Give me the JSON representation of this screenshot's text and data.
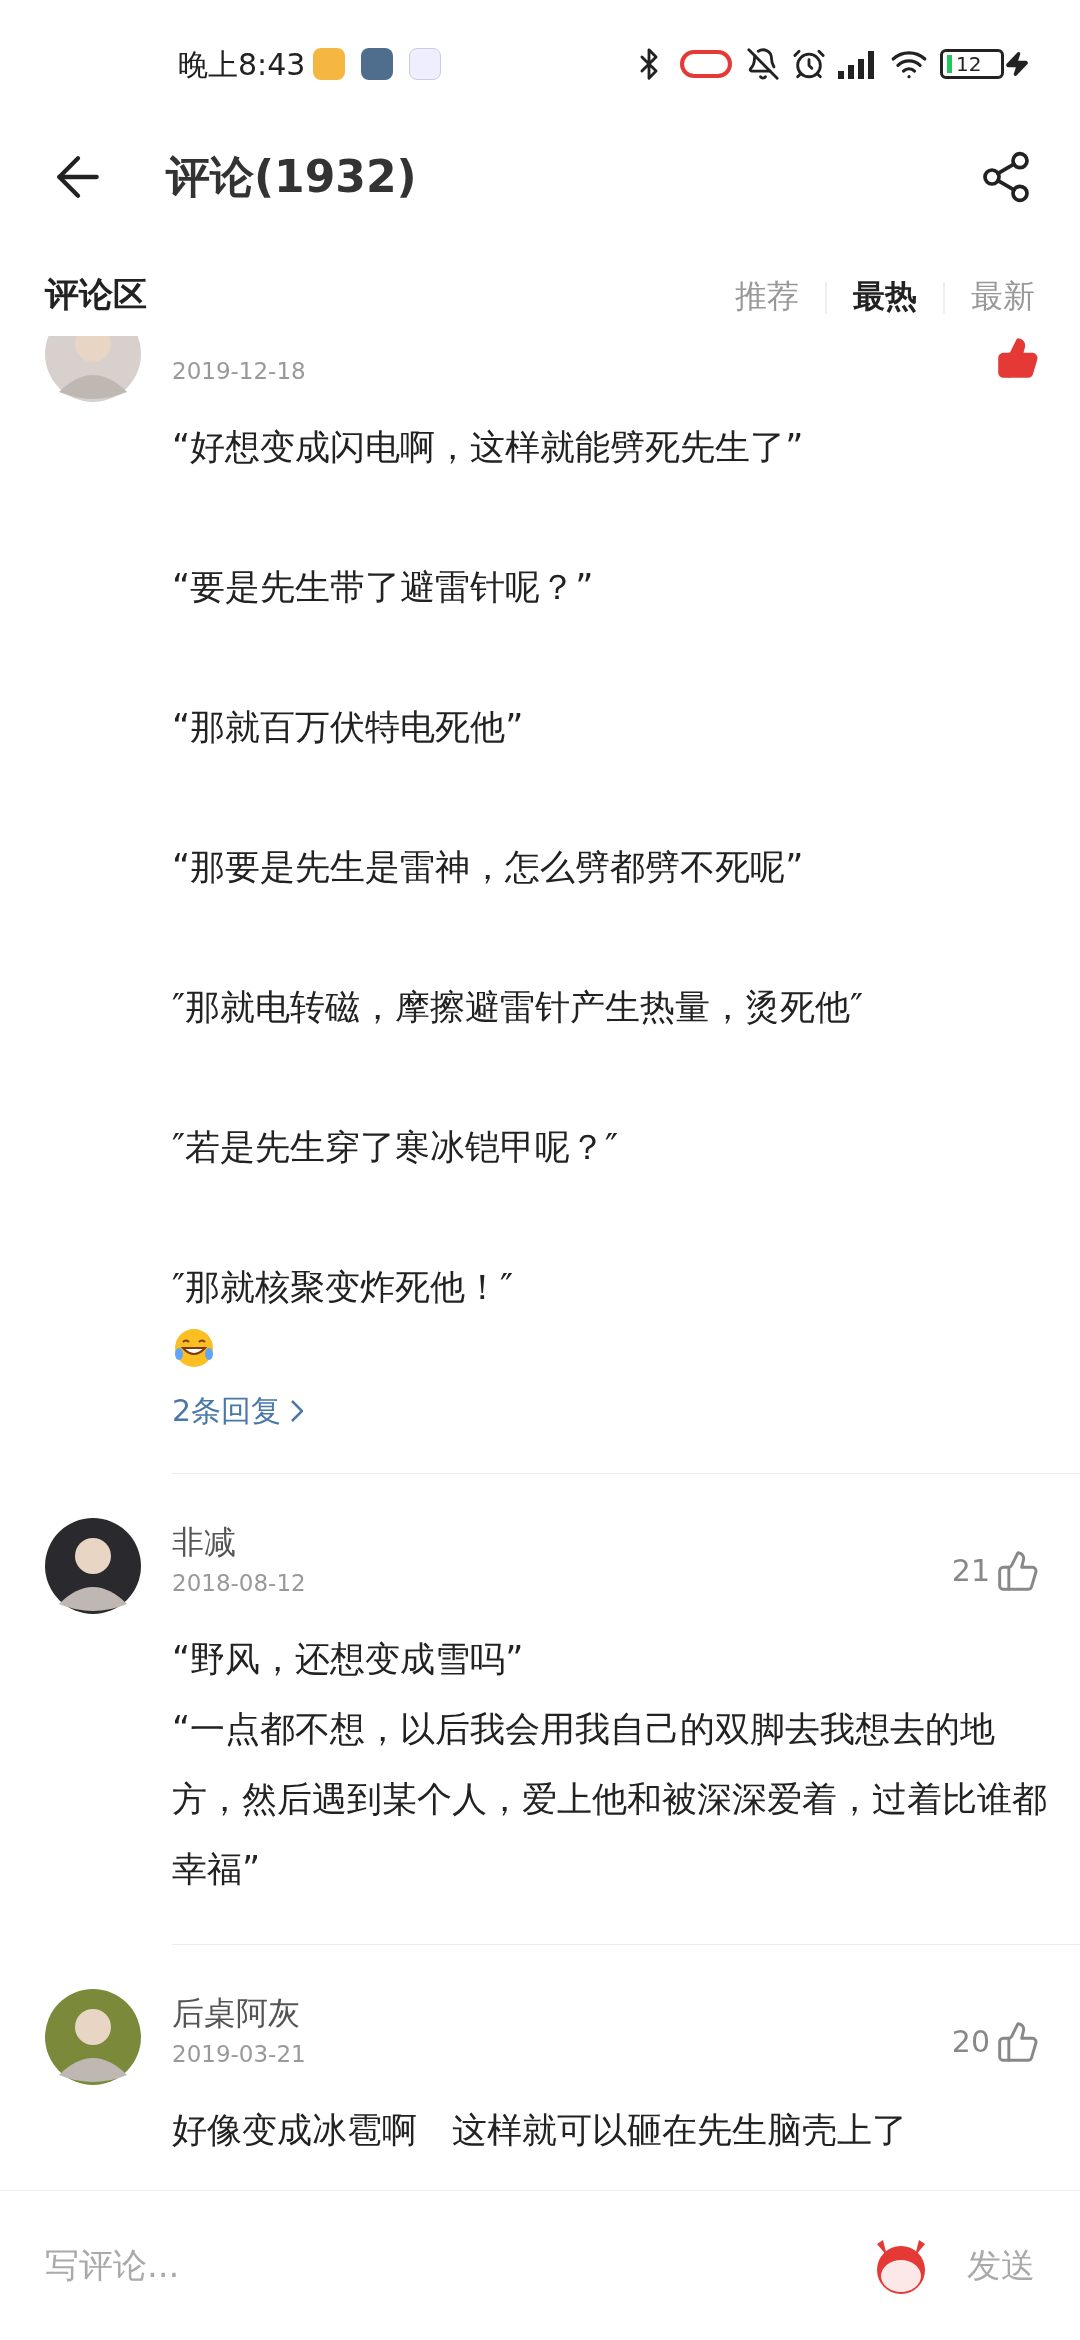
{
  "status_bar": {
    "time": "晚上8:43",
    "battery": "12"
  },
  "header": {
    "title": "评论(1932)"
  },
  "section": {
    "title": "评论区",
    "tabs": [
      {
        "label": "推荐",
        "selected": false
      },
      {
        "label": "最热",
        "selected": true
      },
      {
        "label": "最新",
        "selected": false
      }
    ]
  },
  "comments": [
    {
      "date": "2019-12-18",
      "liked": true,
      "text": "“好想变成闪电啊，这样就能劈死先生了”\n\n“要是先生带了避雷针呢？”\n\n“那就百万伏特电死他”\n\n“那要是先生是雷神，怎么劈都劈不死呢”\n\n″那就电转磁，摩擦避雷针产生热量，烫死他″\n\n″若是先生穿了寒冰铠甲呢？″\n\n″那就核聚变炸死他！″",
      "emoji": true,
      "replies": "2条回复"
    },
    {
      "name": "非减",
      "date": "2018-08-12",
      "likes": "21",
      "liked": false,
      "text": "“野风，还想变成雪吗”\n“一点都不想，以后我会用我自己的双脚去我想去的地方，然后遇到某个人，爱上他和被深深爱着，过着比谁都幸福”"
    },
    {
      "name": "后桌阿灰",
      "date": "2019-03-21",
      "likes": "20",
      "liked": false,
      "text": "好像变成冰雹啊　这样就可以砸在先生脑壳上了"
    }
  ],
  "composer": {
    "placeholder": "写评论...",
    "send": "发送"
  }
}
